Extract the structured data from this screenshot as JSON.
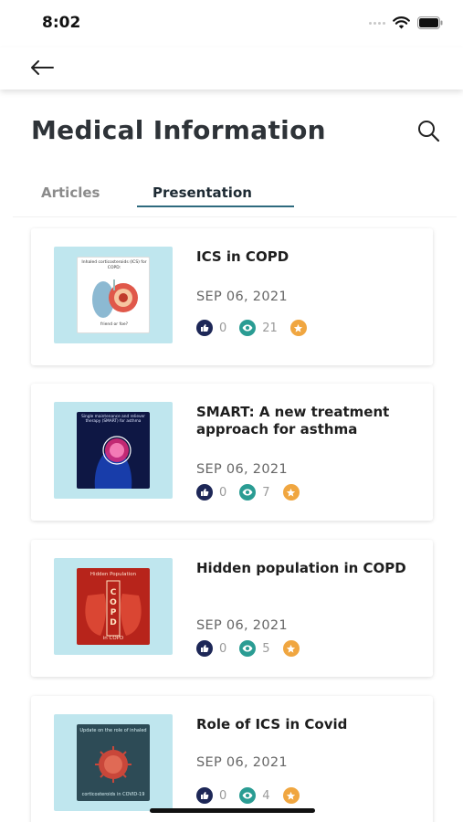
{
  "status_bar": {
    "time": "8:02"
  },
  "header": {
    "title": "Medical Information"
  },
  "tabs": [
    {
      "label": "Articles",
      "active": false
    },
    {
      "label": "Presentation",
      "active": true
    }
  ],
  "items": [
    {
      "title": "ICS in COPD",
      "date": "SEP 06, 2021",
      "likes": "0",
      "views": "21",
      "thumb_text": {
        "top": "Inhaled corticosteroids (ICS) for COPD:",
        "bottom": "friend or foe?"
      }
    },
    {
      "title": "SMART: A new treatment approach for asthma",
      "date": "SEP 06, 2021",
      "likes": "0",
      "views": "7",
      "thumb_text": {
        "top": "Single maintenance and reliever therapy (SMART) for asthma"
      }
    },
    {
      "title": "Hidden population in COPD",
      "date": "SEP 06, 2021",
      "likes": "0",
      "views": "5",
      "thumb_text": {
        "top": "Hidden Population",
        "center": "COPD",
        "bottom": "in COPD"
      }
    },
    {
      "title": "Role of ICS in Covid",
      "date": "SEP 06, 2021",
      "likes": "0",
      "views": "4",
      "thumb_text": {
        "top": "Update on the role of inhaled",
        "bottom": "corticosteroids in COVID-19"
      }
    }
  ],
  "colors": {
    "accent": "#2e6a7e",
    "like_icon": "#1d2757",
    "view_icon": "#2a9c93",
    "star_icon": "#f0a640",
    "thumb_bg": "#bfe6ee"
  }
}
